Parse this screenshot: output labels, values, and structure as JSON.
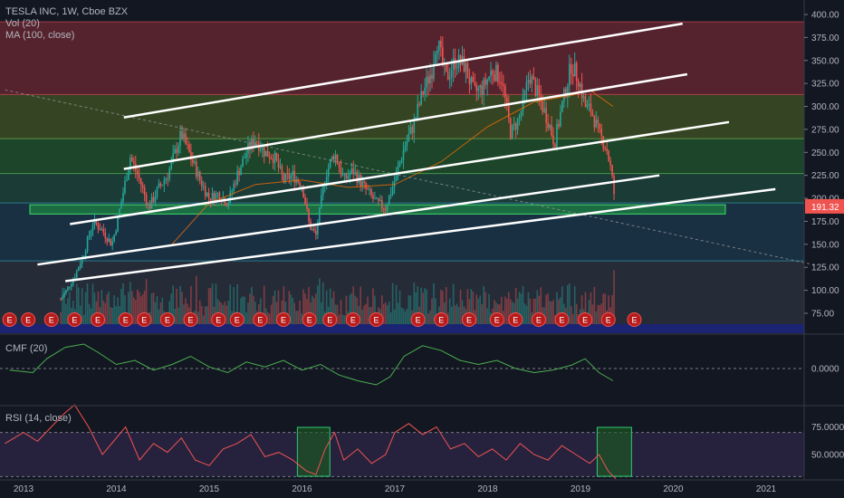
{
  "legend": {
    "title": "TESLA INC, 1W, Cboe BZX",
    "vol": "Vol (20)",
    "ma": "MA (100, close)",
    "cmf": "CMF (20)",
    "rsi": "RSI (14, close)"
  },
  "price_badge": "191.32",
  "earnings_marker": "E",
  "colors": {
    "background": "#131722",
    "up": "#26a69a",
    "down": "#ef5350",
    "ma": "#ff6d00",
    "cmf": "#4caf50",
    "rsi": "#ef5350",
    "trendline": "#ffffff",
    "fib_band_top": "#5d2530",
    "fib_band_2": "#3a4a24",
    "fib_band_3": "#1f4a2a",
    "fib_band_4": "#1d3f3a",
    "fib_band_5": "#1b3347",
    "fib_band_6": "#262b38",
    "support_box": "#1f9e43",
    "price_badge": "#ef5350"
  },
  "chart_data": [
    {
      "type": "candlestick",
      "title": "TESLA INC, 1W, Cboe BZX",
      "x_ticks": [
        "2013",
        "2014",
        "2015",
        "2016",
        "2017",
        "2018",
        "2019",
        "2020",
        "2021"
      ],
      "y_ticks": [
        "400.00",
        "375.00",
        "350.00",
        "325.00",
        "300.00",
        "275.00",
        "250.00",
        "225.00",
        "200.00",
        "175.00",
        "150.00",
        "125.00",
        "100.00",
        "75.00"
      ],
      "ylim": [
        60,
        405
      ],
      "last_price": 191.32,
      "fib_levels": [
        392,
        313,
        265,
        227,
        195,
        132
      ],
      "support_zone": [
        183,
        193
      ],
      "price_path": [
        [
          2013.4,
          90
        ],
        [
          2013.55,
          115
        ],
        [
          2013.65,
          140
        ],
        [
          2013.75,
          175
        ],
        [
          2013.85,
          165
        ],
        [
          2013.95,
          150
        ],
        [
          2014.0,
          170
        ],
        [
          2014.1,
          220
        ],
        [
          2014.15,
          245
        ],
        [
          2014.25,
          220
        ],
        [
          2014.35,
          190
        ],
        [
          2014.45,
          210
        ],
        [
          2014.55,
          225
        ],
        [
          2014.65,
          255
        ],
        [
          2014.7,
          270
        ],
        [
          2014.8,
          245
        ],
        [
          2014.9,
          220
        ],
        [
          2015.0,
          200
        ],
        [
          2015.1,
          205
        ],
        [
          2015.2,
          195
        ],
        [
          2015.3,
          225
        ],
        [
          2015.4,
          250
        ],
        [
          2015.5,
          265
        ],
        [
          2015.6,
          250
        ],
        [
          2015.7,
          245
        ],
        [
          2015.8,
          220
        ],
        [
          2015.9,
          225
        ],
        [
          2016.0,
          215
        ],
        [
          2016.08,
          170
        ],
        [
          2016.15,
          160
        ],
        [
          2016.25,
          225
        ],
        [
          2016.35,
          250
        ],
        [
          2016.45,
          220
        ],
        [
          2016.55,
          230
        ],
        [
          2016.65,
          215
        ],
        [
          2016.8,
          195
        ],
        [
          2016.9,
          190
        ],
        [
          2017.0,
          220
        ],
        [
          2017.1,
          255
        ],
        [
          2017.2,
          280
        ],
        [
          2017.3,
          315
        ],
        [
          2017.4,
          340
        ],
        [
          2017.45,
          375
        ],
        [
          2017.55,
          330
        ],
        [
          2017.65,
          350
        ],
        [
          2017.75,
          345
        ],
        [
          2017.85,
          315
        ],
        [
          2017.95,
          320
        ],
        [
          2018.05,
          340
        ],
        [
          2018.15,
          330
        ],
        [
          2018.25,
          270
        ],
        [
          2018.35,
          290
        ],
        [
          2018.45,
          335
        ],
        [
          2018.55,
          310
        ],
        [
          2018.65,
          285
        ],
        [
          2018.72,
          260
        ],
        [
          2018.8,
          300
        ],
        [
          2018.9,
          345
        ],
        [
          2018.98,
          330
        ],
        [
          2019.05,
          300
        ],
        [
          2019.12,
          295
        ],
        [
          2019.2,
          270
        ],
        [
          2019.28,
          255
        ],
        [
          2019.33,
          230
        ],
        [
          2019.38,
          191
        ]
      ],
      "moving_average": [
        [
          2014.6,
          150
        ],
        [
          2015.0,
          195
        ],
        [
          2015.5,
          215
        ],
        [
          2016.0,
          220
        ],
        [
          2016.5,
          212
        ],
        [
          2017.0,
          215
        ],
        [
          2017.5,
          240
        ],
        [
          2018.0,
          278
        ],
        [
          2018.5,
          305
        ],
        [
          2018.9,
          312
        ],
        [
          2019.1,
          318
        ],
        [
          2019.35,
          300
        ]
      ],
      "earnings_markers_x": [
        2012.85,
        2013.05,
        2013.3,
        2013.55,
        2013.8,
        2014.1,
        2014.3,
        2014.55,
        2014.8,
        2015.1,
        2015.3,
        2015.55,
        2015.8,
        2016.08,
        2016.3,
        2016.55,
        2016.8,
        2017.25,
        2017.5,
        2017.8,
        2018.1,
        2018.3,
        2018.55,
        2018.8,
        2019.05,
        2019.3,
        2019.58
      ],
      "trendlines": [
        [
          [
            2014.08,
            288
          ],
          [
            2020.1,
            390
          ]
        ],
        [
          [
            2014.08,
            232
          ],
          [
            2020.15,
            335
          ]
        ],
        [
          [
            2013.5,
            172
          ],
          [
            2020.6,
            283
          ]
        ],
        [
          [
            2013.15,
            128
          ],
          [
            2019.85,
            225
          ]
        ],
        [
          [
            2013.45,
            110
          ],
          [
            2021.1,
            210
          ]
        ]
      ],
      "dashed_line": [
        [
          2012.8,
          318
        ],
        [
          2021.55,
          127
        ]
      ]
    },
    {
      "type": "line",
      "title": "CMF (20)",
      "y_ticks": [
        "0.0000"
      ],
      "ylim": [
        -0.35,
        0.35
      ],
      "series": [
        {
          "name": "CMF (20)",
          "values": [
            [
              2012.85,
              -0.02
            ],
            [
              2013.1,
              -0.05
            ],
            [
              2013.25,
              0.12
            ],
            [
              2013.45,
              0.26
            ],
            [
              2013.65,
              0.3
            ],
            [
              2013.8,
              0.2
            ],
            [
              2014.0,
              0.05
            ],
            [
              2014.2,
              0.1
            ],
            [
              2014.4,
              -0.02
            ],
            [
              2014.6,
              0.05
            ],
            [
              2014.8,
              0.15
            ],
            [
              2015.0,
              0.02
            ],
            [
              2015.2,
              -0.05
            ],
            [
              2015.4,
              0.08
            ],
            [
              2015.6,
              0.02
            ],
            [
              2015.8,
              0.1
            ],
            [
              2016.0,
              -0.02
            ],
            [
              2016.2,
              0.05
            ],
            [
              2016.4,
              -0.08
            ],
            [
              2016.6,
              -0.15
            ],
            [
              2016.8,
              -0.2
            ],
            [
              2016.95,
              -0.1
            ],
            [
              2017.1,
              0.15
            ],
            [
              2017.3,
              0.28
            ],
            [
              2017.5,
              0.22
            ],
            [
              2017.7,
              0.1
            ],
            [
              2017.9,
              0.05
            ],
            [
              2018.1,
              0.1
            ],
            [
              2018.3,
              0.0
            ],
            [
              2018.5,
              -0.05
            ],
            [
              2018.7,
              -0.02
            ],
            [
              2018.9,
              0.04
            ],
            [
              2019.05,
              0.12
            ],
            [
              2019.2,
              -0.05
            ],
            [
              2019.35,
              -0.15
            ]
          ]
        }
      ]
    },
    {
      "type": "line",
      "title": "RSI (14, close)",
      "y_ticks": [
        "75.0000",
        "50.0000"
      ],
      "ylim": [
        28,
        95
      ],
      "bands": [
        70,
        30
      ],
      "series": [
        {
          "name": "RSI (14, close)",
          "values": [
            [
              2012.8,
              60
            ],
            [
              2013.0,
              70
            ],
            [
              2013.15,
              62
            ],
            [
              2013.3,
              75
            ],
            [
              2013.45,
              88
            ],
            [
              2013.55,
              95
            ],
            [
              2013.7,
              75
            ],
            [
              2013.85,
              50
            ],
            [
              2014.0,
              65
            ],
            [
              2014.1,
              75
            ],
            [
              2014.25,
              45
            ],
            [
              2014.4,
              60
            ],
            [
              2014.55,
              52
            ],
            [
              2014.7,
              65
            ],
            [
              2014.85,
              45
            ],
            [
              2015.0,
              40
            ],
            [
              2015.15,
              55
            ],
            [
              2015.3,
              60
            ],
            [
              2015.45,
              68
            ],
            [
              2015.6,
              48
            ],
            [
              2015.75,
              52
            ],
            [
              2015.9,
              45
            ],
            [
              2016.05,
              35
            ],
            [
              2016.15,
              32
            ],
            [
              2016.25,
              55
            ],
            [
              2016.35,
              70
            ],
            [
              2016.45,
              45
            ],
            [
              2016.6,
              55
            ],
            [
              2016.75,
              42
            ],
            [
              2016.9,
              50
            ],
            [
              2017.0,
              70
            ],
            [
              2017.15,
              78
            ],
            [
              2017.3,
              68
            ],
            [
              2017.45,
              75
            ],
            [
              2017.6,
              55
            ],
            [
              2017.75,
              60
            ],
            [
              2017.9,
              48
            ],
            [
              2018.05,
              55
            ],
            [
              2018.2,
              45
            ],
            [
              2018.35,
              60
            ],
            [
              2018.5,
              50
            ],
            [
              2018.65,
              45
            ],
            [
              2018.8,
              58
            ],
            [
              2018.95,
              50
            ],
            [
              2019.1,
              42
            ],
            [
              2019.2,
              50
            ],
            [
              2019.3,
              35
            ],
            [
              2019.38,
              28
            ]
          ]
        }
      ],
      "highlight_boxes": [
        [
          2015.95,
          2016.3
        ],
        [
          2019.18,
          2019.55
        ]
      ]
    }
  ]
}
